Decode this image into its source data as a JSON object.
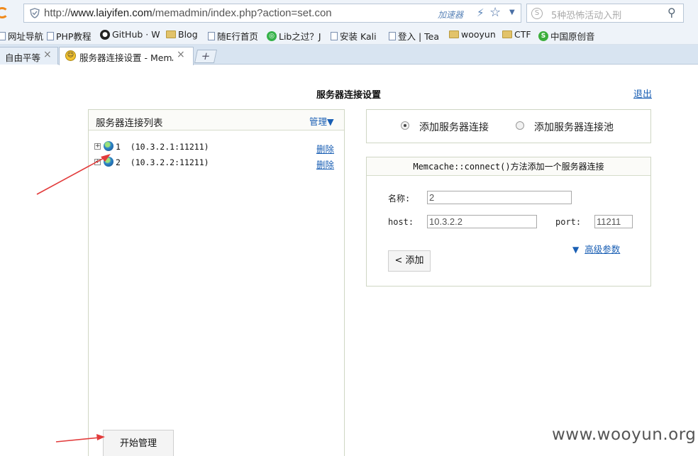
{
  "browser": {
    "url_prefix": "http://",
    "url_host": "www.laiyifen.com",
    "url_path": "/memadmin/index.php?action=set.con",
    "accelerator_label": "加速器",
    "search_placeholder": "5种恐怖活动入刑",
    "bookmarks": [
      {
        "label": "网址导航",
        "icon": "doc-icon"
      },
      {
        "label": "PHP教程",
        "icon": "doc-icon"
      },
      {
        "label": "GitHub · W",
        "icon": "github-icon"
      },
      {
        "label": "Blog",
        "icon": "folder-icon"
      },
      {
        "label": "随E行首页",
        "icon": "doc-icon"
      },
      {
        "label": "Lib之过？J",
        "icon": "round-green-icon"
      },
      {
        "label": "安装 Kali",
        "icon": "doc-icon"
      },
      {
        "label": "登入 | Tea",
        "icon": "doc-icon"
      },
      {
        "label": "wooyun",
        "icon": "folder-icon"
      },
      {
        "label": "CTF",
        "icon": "folder-icon"
      },
      {
        "label": "中国原创音",
        "icon": "round-green-icon"
      }
    ],
    "tabs": [
      {
        "label": "自由平等"
      },
      {
        "label": "服务器连接设置 - MemA"
      }
    ]
  },
  "page": {
    "title": "服务器连接设置",
    "logout_label": "退出",
    "server_list": {
      "title": "服务器连接列表",
      "manage_label": "管理▼",
      "items": [
        {
          "text": "1  (10.3.2.1:11211)",
          "delete_label": "删除"
        },
        {
          "text": "2  (10.3.2.2:11211)",
          "delete_label": "删除"
        }
      ],
      "start_button": "开始管理"
    },
    "mode": {
      "option_add_server": "添加服务器连接",
      "option_add_pool": "添加服务器连接池",
      "selected": "option_add_server"
    },
    "form": {
      "header": "Memcache::connect()方法添加一个服务器连接",
      "name_label": "名称:",
      "name_value": "2",
      "host_label": "host:",
      "host_value": "10.3.2.2",
      "port_label": "port:",
      "port_value": "11211",
      "advanced_label": "高级参数",
      "add_button": "< 添加"
    }
  },
  "watermark": "www.wooyun.org",
  "colors": {
    "link": "#1a5fb4",
    "annotation_arrow": "#e23b3b",
    "panel_border": "#cfd6c4"
  }
}
